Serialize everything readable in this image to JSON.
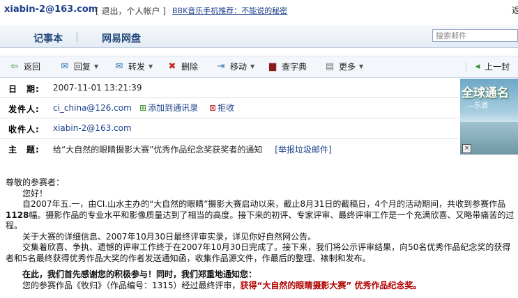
{
  "top": {
    "account": "xiabin-2@163.com",
    "links_prefix": "[ ",
    "logout": "退出",
    "separator": "，",
    "personal": "个人帐户",
    "links_suffix": " ]",
    "promo": "BBK音乐手机推荐：不能说的秘密",
    "cut_text": "返"
  },
  "nav": {
    "tabs": [
      "记事本",
      "网易网盘"
    ],
    "search_placeholder": "搜索邮件"
  },
  "toolbar": {
    "back": "返回",
    "reply": "回复",
    "forward": "转发",
    "delete": "删除",
    "move": "移动",
    "dictionary": "查字典",
    "more": "更多",
    "prev": "上一封"
  },
  "headers": {
    "date_label": "日　期:",
    "date_value": "2007-11-01 13:21:39",
    "from_label": "发件人:",
    "from_value": "ci_china@126.com",
    "add_contact": "添加到通讯录",
    "reject": "拒收",
    "to_label": "收件人:",
    "to_value": "xiabin-2@163.com",
    "subject_label": "主　题:",
    "subject_value": "给“大自然的眼睛摄影大赛”优秀作品纪念奖获奖者的通知",
    "report_spam": "[举报垃圾邮件]"
  },
  "ad": {
    "title": "全球通名",
    "subtitle": "—乐游"
  },
  "body": {
    "greeting": "尊敬的参赛者：",
    "hello": "您好！",
    "p1a": "自2007年五.一，由CI.山水主办的“大自然的眼睛”摄影大赛启动以来，截止8月31日的截稿日，4个月的活动期间，共收到参赛作品",
    "p1b": "1128",
    "p1c": "幅。摄影作品的专业水平和影像质量达到了相当的高度。接下来的初评、专家评审、最终评审工作是一个充满欣喜、又略带痛苦的过程。",
    "p2": "关于大赛的详细信息、2007年10月30日最终评审实录，详见你好自然网公告。",
    "p3": "交集着欣喜、争执、遗憾的评审工作终于在2007年10月30日完成了。接下来，我们将公示评审结果，向50名优秀作品纪念奖的获得者和5名最终获得优秀作品大奖的作者发送通知函，收集作品源文件，作最后的整理、裱制和发布。",
    "thanks": "在此，我们首先感谢您的积极参与！同时，我们郑重地通知您：",
    "p4a": "您的参赛作品《牧归》（作品编号：1315）经过最终评审，",
    "p4b": "获得“大自然的眼睛摄影大赛” 优秀作品纪念奖。"
  },
  "colors": {
    "link": "#1b3f8b",
    "award_red": "#b00000",
    "nav_text": "#244a7c"
  }
}
